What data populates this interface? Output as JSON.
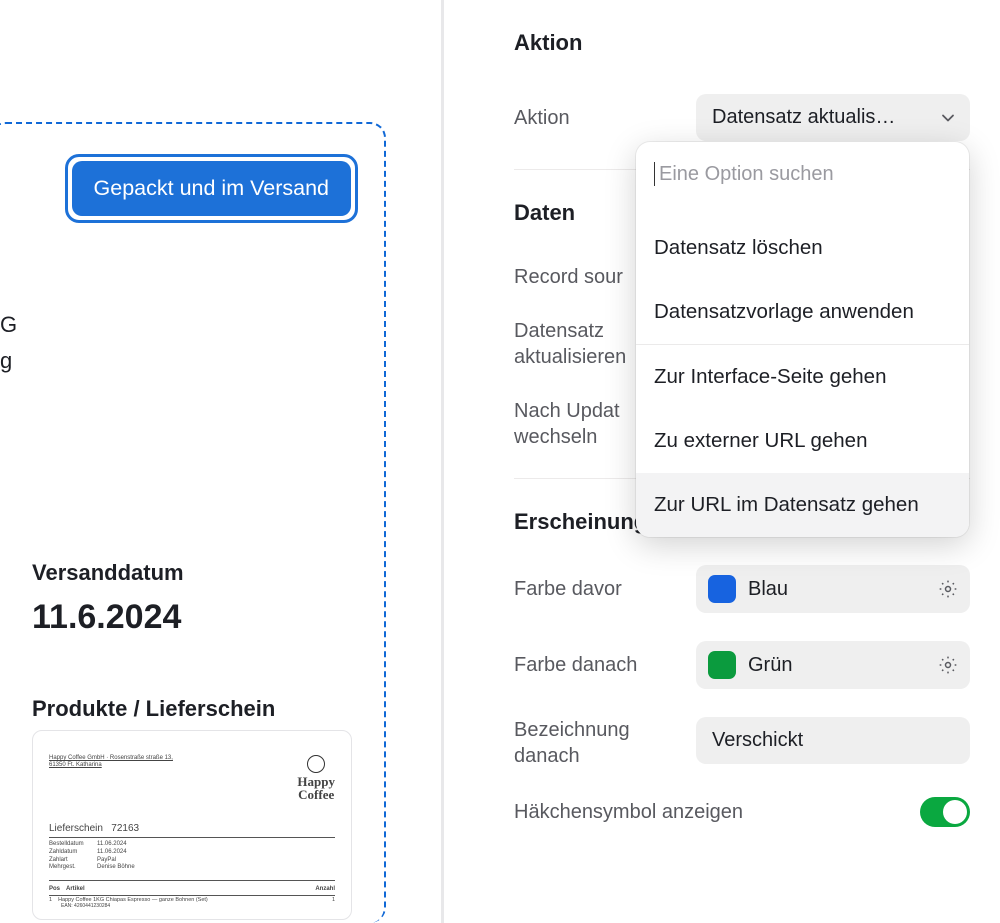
{
  "left": {
    "primary_button": "Gepackt und im Versand",
    "crop_g1": "G",
    "crop_g2": "g",
    "date_label": "Versanddatum",
    "date_value": "11.6.2024",
    "products_label": "Produkte / Lieferschein",
    "doc": {
      "addr": "Happy Coffee GmbH · Rosenstraße straße 13, 61350 Ft. Katharina",
      "logo": "Happy Coffee",
      "title": "Lieferschein",
      "num": "72163",
      "meta": [
        [
          "Bestelldatum",
          "11.06.2024"
        ],
        [
          "Zahldatum",
          "11.06.2024"
        ],
        [
          "Zahlart",
          "PayPal"
        ],
        [
          "Mehrgest.",
          "Denise Böhne"
        ]
      ],
      "th": [
        "Pos",
        "Artikel",
        "Anzahl"
      ],
      "row": [
        "1",
        "Happy Coffee 1KG Chiapas Espresso — ganze Bohnen (Set)",
        "1"
      ],
      "ean": "EAN: 4260441230284"
    }
  },
  "right": {
    "aktion_title": "Aktion",
    "aktion_label": "Aktion",
    "aktion_value": "Datensatz aktualis…",
    "daten_title": "Daten",
    "record_source_label": "Record sour",
    "update_record_label": "Datensatz aktualisieren",
    "after_update_label": "Nach Updat wechseln",
    "erschein_title": "Erscheinung",
    "farbe_davor_label": "Farbe davor",
    "farbe_davor_value": "Blau",
    "farbe_danach_label": "Farbe danach",
    "farbe_danach_value": "Grün",
    "bez_label": "Bezeichnung danach",
    "bez_value": "Verschickt",
    "haken_label": "Häkchensymbol anzeigen",
    "colors": {
      "blue": "#1763e0",
      "green": "#0b9b3e",
      "accent": "#0aa840"
    }
  },
  "dropdown": {
    "search_placeholder": "Eine Option suchen",
    "items": [
      "Datensatz löschen",
      "Datensatzvorlage anwenden",
      "Zur Interface-Seite gehen",
      "Zu externer URL gehen",
      "Zur URL im Datensatz gehen"
    ]
  }
}
